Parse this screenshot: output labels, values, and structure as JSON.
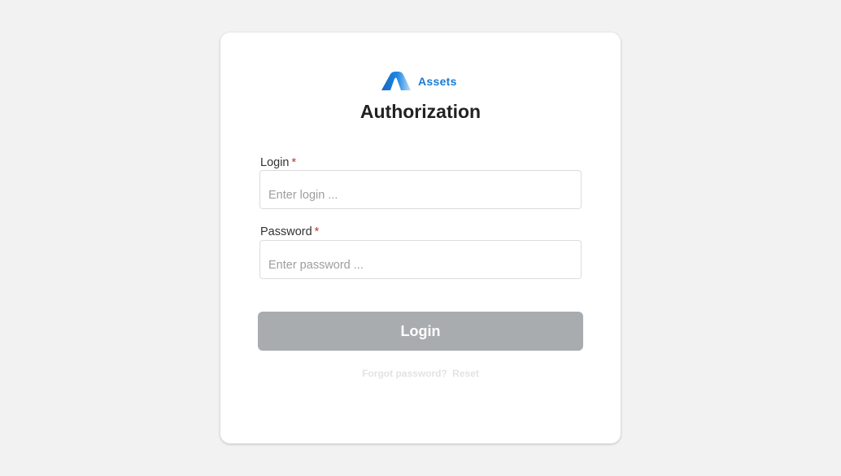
{
  "brand": {
    "name": "Assets",
    "logo_icon": "mountain-logo-icon",
    "color": "#1a7ad4"
  },
  "title": "Authorization",
  "form": {
    "login": {
      "label": "Login",
      "required_marker": "*",
      "placeholder": "Enter login ...",
      "value": ""
    },
    "password": {
      "label": "Password",
      "required_marker": "*",
      "placeholder": "Enter password ...",
      "value": ""
    },
    "submit_label": "Login"
  },
  "footer": {
    "forgot_text": "Forgot password?",
    "reset_label": "Reset"
  },
  "colors": {
    "background": "#f2f2f2",
    "card": "#ffffff",
    "button_disabled": "#a9acaf",
    "required": "#c0392b"
  }
}
